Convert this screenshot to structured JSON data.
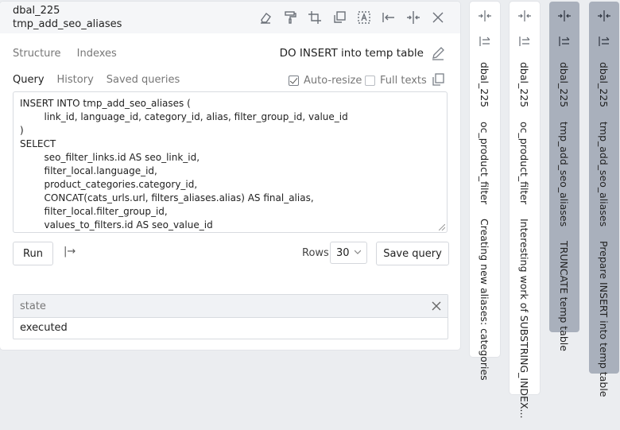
{
  "panel": {
    "db_name": "dbal_225",
    "table_name": "tmp_add_seo_aliases",
    "toolbar_icons": [
      "eraser-icon",
      "paint-roller-icon",
      "crop-icon",
      "duplicate-icon",
      "text-select-icon",
      "collapse-left-icon",
      "split-vertical-icon",
      "close-icon"
    ]
  },
  "tabs_top": {
    "structure": "Structure",
    "indexes": "Indexes"
  },
  "query_title": "DO INSERT into temp table",
  "tabs_query": {
    "query": "Query",
    "history": "History",
    "saved": "Saved queries"
  },
  "options": {
    "auto_resize": "Auto-resize",
    "full_texts": "Full texts"
  },
  "sql": "INSERT INTO tmp_add_seo_aliases (\n        link_id, language_id, category_id, alias, filter_group_id, value_id\n)\nSELECT\n        seo_filter_links.id AS seo_link_id,\n        filter_local.language_id,\n        product_categories.category_id,\n        CONCAT(cats_urls.url, filters_aliases.alias) AS final_alias,\n        filter_local.filter_group_id,\n        values_to_filters.id AS seo_value_id",
  "controls": {
    "run": "Run",
    "run_arrow": "|→",
    "rows_label": "Rows",
    "rows_value": "30",
    "save": "Save query"
  },
  "result": {
    "header": "state",
    "value": "executed"
  },
  "side_tabs": [
    {
      "db": "dbal_225",
      "table": "oc_product_filter",
      "desc": "Creating new aliases: categories"
    },
    {
      "db": "dbal_225",
      "table": "oc_product_filter",
      "desc": "Interesting work of SUBSTRING_INDEX..."
    },
    {
      "db": "dbal_225",
      "table": "tmp_add_seo_aliases",
      "desc": "TRUNCATE temp table"
    },
    {
      "db": "dbal_225",
      "table": "tmp_add_seo_aliases",
      "desc": "Prepare INSERT into temp table"
    }
  ]
}
